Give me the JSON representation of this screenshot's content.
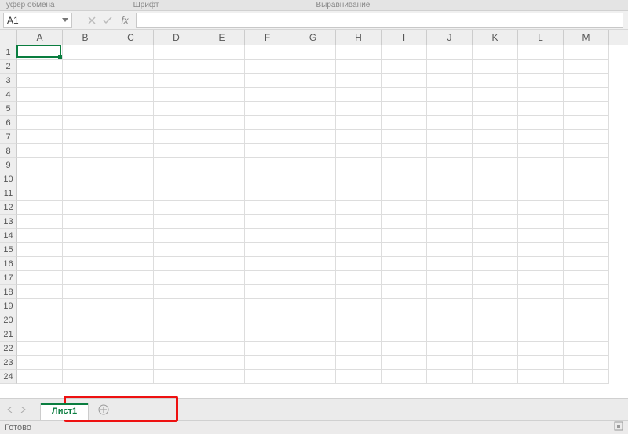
{
  "top_strip": {
    "group1": "уфер обмена",
    "group2": "Шрифт",
    "group3": "Выравнивание"
  },
  "formula": {
    "cell_ref": "A1",
    "fx_label": "fx"
  },
  "grid": {
    "columns": [
      "A",
      "B",
      "C",
      "D",
      "E",
      "F",
      "G",
      "H",
      "I",
      "J",
      "K",
      "L",
      "M"
    ],
    "row_count": 24,
    "selected": {
      "col_index": 0,
      "row_index": 0
    }
  },
  "tabs": {
    "sheet1": "Лист1"
  },
  "status": {
    "ready": "Готово"
  }
}
